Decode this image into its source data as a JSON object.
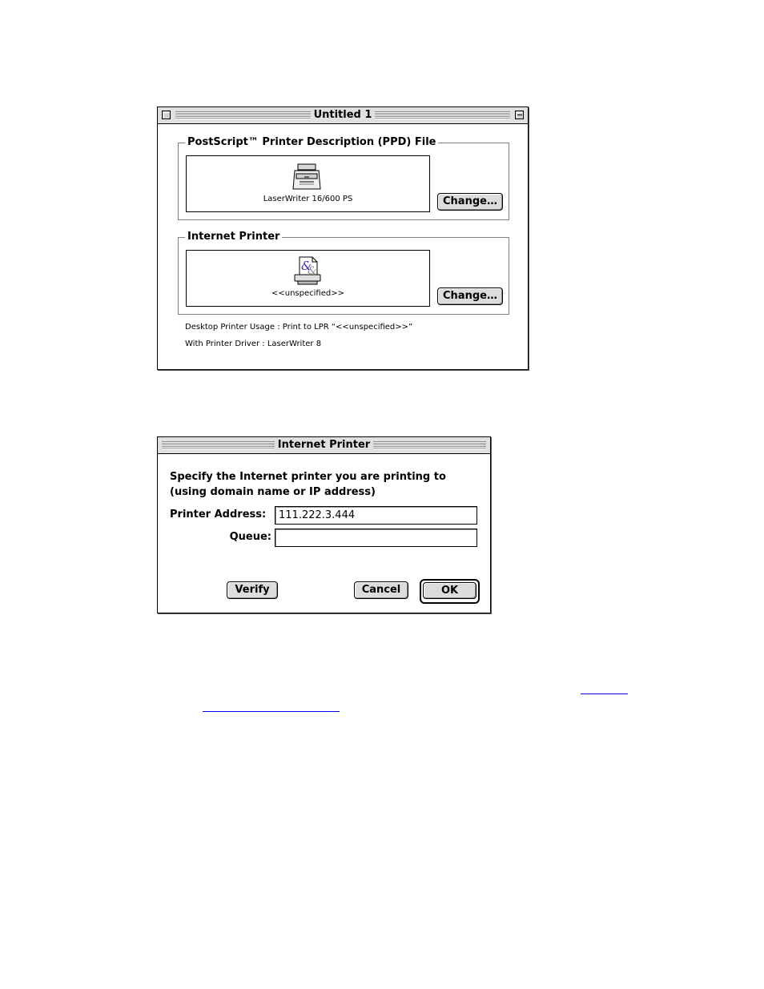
{
  "window1": {
    "title": "Untitled 1",
    "ppd_group": {
      "label": "PostScript™ Printer Description (PPD) File",
      "selected_name": "LaserWriter 16/600 PS",
      "change_button": "Change…",
      "icon": "laser-printer-icon"
    },
    "internet_group": {
      "label": "Internet Printer",
      "selected_name": "<<unspecified>>",
      "change_button": "Change…",
      "icon": "lpr-printer-icon"
    },
    "usage_text": "Desktop Printer Usage : Print to LPR “<<unspecified>>”",
    "driver_text": "With Printer Driver : LaserWriter 8"
  },
  "dialog": {
    "title": "Internet Printer",
    "prompt_line1": "Specify the Internet printer you are printing to",
    "prompt_line2": "(using domain name or IP address)",
    "address_label": "Printer Address:",
    "address_value": "111.222.3.444",
    "queue_label": "Queue:",
    "queue_value": "",
    "verify_button": "Verify",
    "cancel_button": "Cancel",
    "ok_button": "OK"
  },
  "colors": {
    "link": "#0000ee",
    "button_face": "#dcdcdc",
    "titlebar": "#e0e0e0"
  }
}
